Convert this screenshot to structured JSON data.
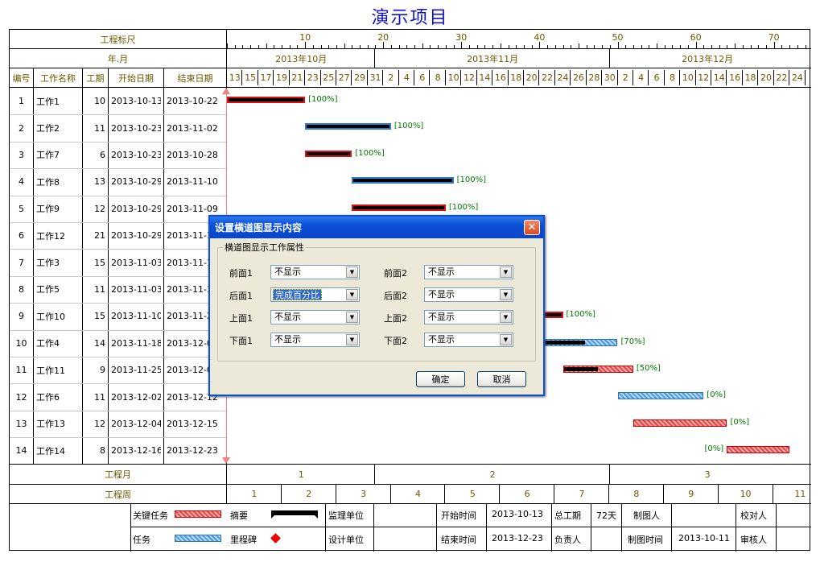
{
  "page_title": "演示项目",
  "header": {
    "scale_label": "工程标尺",
    "yearmonth_label": "年.月",
    "scale_ticks": [
      "10",
      "20",
      "30",
      "40",
      "50",
      "60",
      "70"
    ],
    "months": [
      "2013年10月",
      "2013年11月",
      "2013年12月"
    ],
    "days": [
      "13",
      "15",
      "17",
      "19",
      "21",
      "23",
      "25",
      "27",
      "29",
      "31",
      "2",
      "4",
      "6",
      "8",
      "10",
      "12",
      "14",
      "16",
      "18",
      "20",
      "22",
      "24",
      "26",
      "28",
      "30",
      "2",
      "4",
      "6",
      "8",
      "10",
      "12",
      "14",
      "16",
      "18",
      "20",
      "22",
      "24"
    ]
  },
  "columns": [
    "编号",
    "工作名称",
    "工期",
    "开始日期",
    "结束日期"
  ],
  "tasks": [
    {
      "id": "1",
      "name": "工作1",
      "dur": "10",
      "start": "2013-10-13",
      "end": "2013-10-22",
      "pct": "[100%]"
    },
    {
      "id": "2",
      "name": "工作2",
      "dur": "11",
      "start": "2013-10-23",
      "end": "2013-11-02",
      "pct": "[100%]"
    },
    {
      "id": "3",
      "name": "工作7",
      "dur": "6",
      "start": "2013-10-23",
      "end": "2013-10-28",
      "pct": "[100%]"
    },
    {
      "id": "4",
      "name": "工作8",
      "dur": "13",
      "start": "2013-10-29",
      "end": "2013-11-10",
      "pct": "[100%]"
    },
    {
      "id": "5",
      "name": "工作9",
      "dur": "12",
      "start": "2013-10-29",
      "end": "2013-11-09",
      "pct": "[100%]"
    },
    {
      "id": "6",
      "name": "工作12",
      "dur": "21",
      "start": "2013-10-29",
      "end": "2013-11-1",
      "pct": ""
    },
    {
      "id": "7",
      "name": "工作3",
      "dur": "15",
      "start": "2013-11-03",
      "end": "2013-11-1",
      "pct": ""
    },
    {
      "id": "8",
      "name": "工作5",
      "dur": "11",
      "start": "2013-11-03",
      "end": "2013-11-1",
      "pct": ""
    },
    {
      "id": "9",
      "name": "工作10",
      "dur": "15",
      "start": "2013-11-10",
      "end": "2013-11-2",
      "pct": "[100%]"
    },
    {
      "id": "10",
      "name": "工作4",
      "dur": "14",
      "start": "2013-11-18",
      "end": "2013-12-0",
      "pct": "[70%]"
    },
    {
      "id": "11",
      "name": "工作11",
      "dur": "9",
      "start": "2013-11-25",
      "end": "2013-12-0",
      "pct": "[50%]"
    },
    {
      "id": "12",
      "name": "工作6",
      "dur": "11",
      "start": "2013-12-02",
      "end": "2013-12-12",
      "pct": "[0%]"
    },
    {
      "id": "13",
      "name": "工作13",
      "dur": "12",
      "start": "2013-12-04",
      "end": "2013-12-15",
      "pct": "[0%]"
    },
    {
      "id": "14",
      "name": "工作14",
      "dur": "8",
      "start": "2013-12-16",
      "end": "2013-12-23",
      "pct": "[0%]"
    }
  ],
  "footer": {
    "month_label": "工程月",
    "months": [
      "1",
      "2",
      "3"
    ],
    "week_label": "工程周",
    "weeks": [
      "1",
      "2",
      "3",
      "4",
      "5",
      "6",
      "7",
      "8",
      "9",
      "10",
      "11"
    ],
    "legend": {
      "critical": "关键任务",
      "summary": "摘要",
      "task": "任务",
      "milestone": "里程碑"
    },
    "info": {
      "supervisor": "监理单位",
      "designer": "设计单位",
      "start_label": "开始时间",
      "start": "2013-10-13",
      "end_label": "结束时间",
      "end": "2013-12-23",
      "total_label": "总工期",
      "total": "72天",
      "owner_label": "负责人",
      "drawer_label": "制图人",
      "drawtime_label": "制图时间",
      "drawtime": "2013-10-11",
      "checker_label": "校对人",
      "reviewer_label": "审核人"
    }
  },
  "dialog": {
    "title": "设置横道图显示内容",
    "close": "✕",
    "group": "横道图显示工作属性",
    "fields": [
      {
        "label": "前面1",
        "value": "不显示"
      },
      {
        "label": "前面2",
        "value": "不显示"
      },
      {
        "label": "后面1",
        "value": "完成百分比"
      },
      {
        "label": "后面2",
        "value": "不显示"
      },
      {
        "label": "上面1",
        "value": "不显示"
      },
      {
        "label": "上面2",
        "value": "不显示"
      },
      {
        "label": "下面1",
        "value": "不显示"
      },
      {
        "label": "下面2",
        "value": "不显示"
      }
    ],
    "ok": "确定",
    "cancel": "取消"
  }
}
